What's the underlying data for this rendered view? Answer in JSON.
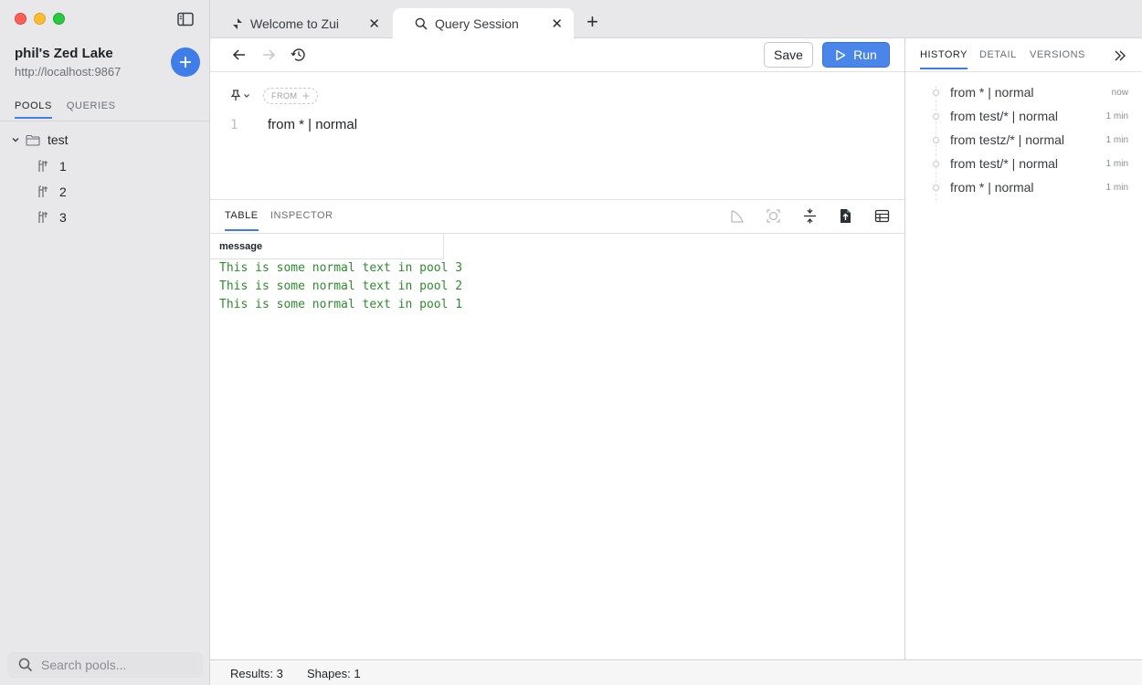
{
  "sidebar": {
    "lake_name": "phil's Zed Lake",
    "lake_url": "http://localhost:9867",
    "tabs": [
      {
        "label": "POOLS",
        "active": true
      },
      {
        "label": "QUERIES",
        "active": false
      }
    ],
    "tree": {
      "root": "test",
      "items": [
        "1",
        "2",
        "3"
      ]
    },
    "search_placeholder": "Search pools..."
  },
  "tabs": [
    {
      "label": "Welcome to Zui",
      "icon": "zui-logo-icon",
      "active": false
    },
    {
      "label": "Query Session",
      "icon": "search-icon",
      "active": true
    }
  ],
  "toolbar": {
    "save_label": "Save",
    "run_label": "Run"
  },
  "editor": {
    "from_pill": "FROM",
    "line_number": "1",
    "code": "from * | normal"
  },
  "results": {
    "tabs": [
      {
        "label": "TABLE",
        "active": true
      },
      {
        "label": "INSPECTOR",
        "active": false
      }
    ],
    "column": "message",
    "rows": [
      "This is some normal text in pool 3",
      "This is some normal text in pool 2",
      "This is some normal text in pool 1"
    ],
    "row_color": "#2e8b2e"
  },
  "right_panel": {
    "tabs": [
      {
        "label": "HISTORY",
        "active": true
      },
      {
        "label": "DETAIL",
        "active": false
      },
      {
        "label": "VERSIONS",
        "active": false
      }
    ],
    "history": [
      {
        "query": "from * | normal",
        "time": "now"
      },
      {
        "query": "from test/* | normal",
        "time": "1 min"
      },
      {
        "query": "from testz/* | normal",
        "time": "1 min"
      },
      {
        "query": "from test/* | normal",
        "time": "1 min"
      },
      {
        "query": "from * | normal",
        "time": "1 min"
      }
    ]
  },
  "status": {
    "results": "Results: 3",
    "shapes": "Shapes: 1"
  },
  "colors": {
    "accent": "#3f7ee8",
    "run_button": "#4a86ea",
    "result_text": "#2e8b2e"
  }
}
